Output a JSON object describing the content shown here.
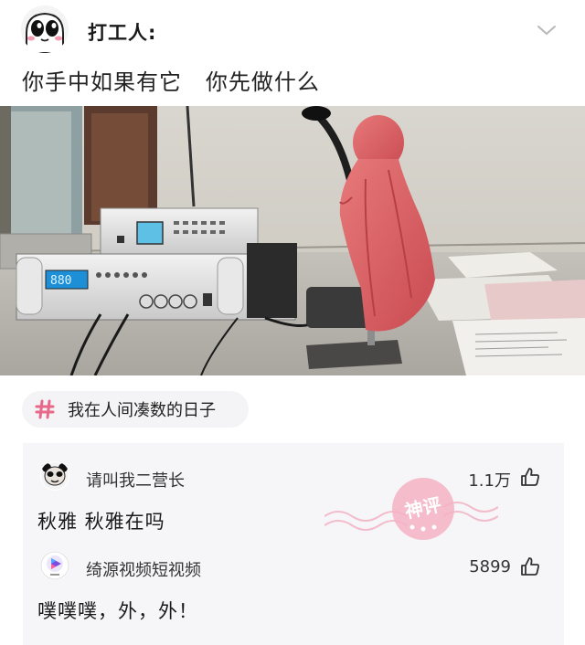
{
  "post": {
    "author": "打工人:",
    "title": "你手中如果有它   你先做什么",
    "topic": "我在人间凑数的日子"
  },
  "photo": {
    "amp_display": "880"
  },
  "comments": [
    {
      "name": "请叫我二营长",
      "likes": "1.1万",
      "text": "秋雅 秋雅在吗",
      "badge": "神评"
    },
    {
      "name": "绮源视频短视频",
      "likes": "5899",
      "text": "噗噗噗，外，外！"
    }
  ],
  "colors": {
    "topic_hash": "#e8688a",
    "stamp": "#e86a86",
    "comment_bg": "#f6f6f8"
  }
}
